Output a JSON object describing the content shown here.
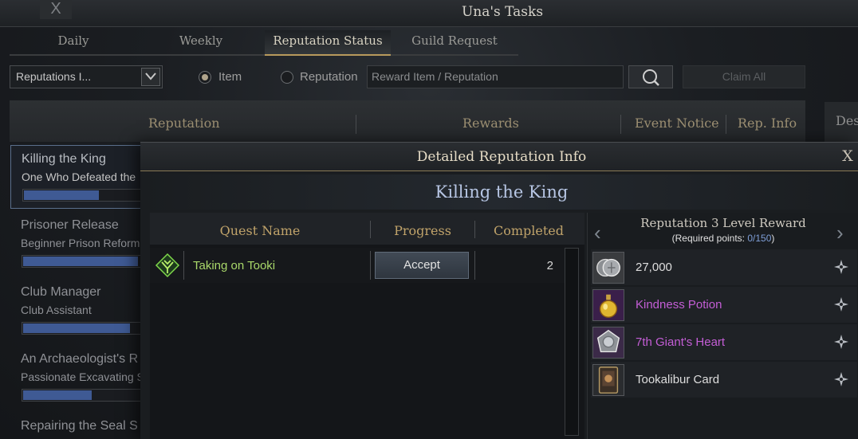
{
  "window": {
    "title": "Una's Tasks",
    "close_glyph": "X"
  },
  "tabs": [
    {
      "label": "Daily",
      "active": false
    },
    {
      "label": "Weekly",
      "active": false
    },
    {
      "label": "Reputation Status",
      "active": true
    },
    {
      "label": "Guild Request",
      "active": false
    }
  ],
  "filters": {
    "dropdown_value": "Reputations I...",
    "dropdown_arrow": "chevron-down-icon",
    "radio_item_label": "Item",
    "radio_reputation_label": "Reputation",
    "selected_radio": "Item",
    "search_placeholder": "Reward Item / Reputation",
    "claim_all_label": "Claim All"
  },
  "table_header": {
    "reputation": "Reputation",
    "rewards": "Rewards",
    "event_notice": "Event Notice",
    "rep_info": "Rep. Info",
    "side_tab": "Des"
  },
  "reputation_list": [
    {
      "name": "Killing the King",
      "subtitle": "One Who Defeated the",
      "progress": 0.6,
      "selected": true
    },
    {
      "name": "Prisoner Release",
      "subtitle": "Beginner Prison Reform",
      "progress": 0.92,
      "selected": false
    },
    {
      "name": "Club Manager",
      "subtitle": "Club Assistant",
      "progress": 0.86,
      "selected": false
    },
    {
      "name": "An Archaeologist's R",
      "subtitle": "Passionate Excavating S",
      "progress": 0.55,
      "selected": false
    },
    {
      "name": "Repairing the Seal S",
      "subtitle": "",
      "progress": 0,
      "selected": false
    }
  ],
  "modal": {
    "title": "Detailed Reputation Info",
    "close_glyph": "X",
    "subtitle": "Killing the King",
    "quest_table": {
      "headers": {
        "quest_name": "Quest Name",
        "progress": "Progress",
        "completed": "Completed"
      },
      "rows": [
        {
          "name": "Taking on Tooki",
          "action": "Accept",
          "completed": "2"
        }
      ]
    },
    "rewards": {
      "title": "Reputation 3 Level Reward",
      "required_prefix": "(Required points: ",
      "required_value": "0/150",
      "required_suffix": ")",
      "prev_glyph": "‹",
      "next_glyph": "›",
      "items": [
        {
          "name": "27,000",
          "icon": "silver-coins-icon",
          "color": "#dedede"
        },
        {
          "name": "Kindness Potion",
          "icon": "potion-icon",
          "color": "#c45ed6"
        },
        {
          "name": "7th Giant's Heart",
          "icon": "giant-heart-icon",
          "color": "#c45ed6"
        },
        {
          "name": "Tookalibur Card",
          "icon": "card-icon",
          "color": "#dedede"
        }
      ]
    }
  }
}
